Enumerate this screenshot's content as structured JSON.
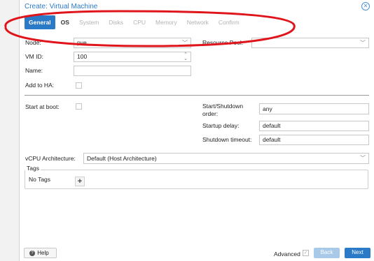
{
  "dialog": {
    "title": "Create: Virtual Machine",
    "close_icon": "close-icon"
  },
  "tabs": [
    {
      "label": "General",
      "state": "active"
    },
    {
      "label": "OS",
      "state": "enabled"
    },
    {
      "label": "System",
      "state": "disabled"
    },
    {
      "label": "Disks",
      "state": "disabled"
    },
    {
      "label": "CPU",
      "state": "disabled"
    },
    {
      "label": "Memory",
      "state": "disabled"
    },
    {
      "label": "Network",
      "state": "disabled"
    },
    {
      "label": "Confirm",
      "state": "disabled"
    }
  ],
  "form": {
    "node_label": "Node:",
    "node_value": "pve",
    "resource_pool_label": "Resource Pool:",
    "resource_pool_value": "",
    "vmid_label": "VM ID:",
    "vmid_value": "100",
    "name_label": "Name:",
    "name_value": "",
    "add_ha_label": "Add to HA:",
    "start_boot_label": "Start at boot:",
    "start_shutdown_label_1": "Start/Shutdown",
    "start_shutdown_label_2": "order:",
    "start_shutdown_value": "any",
    "startup_delay_label": "Startup delay:",
    "startup_delay_value": "default",
    "shutdown_timeout_label": "Shutdown timeout:",
    "shutdown_timeout_value": "default",
    "vcpu_arch_label": "vCPU Architecture:",
    "vcpu_arch_value": "Default (Host Architecture)"
  },
  "tags": {
    "legend": "Tags",
    "none_text": "No Tags",
    "add_symbol": "+"
  },
  "footer": {
    "help_label": "Help",
    "advanced_label": "Advanced",
    "back_label": "Back",
    "next_label": "Next"
  },
  "colors": {
    "accent": "#2b7ac7",
    "annotation_red": "#e0141b"
  }
}
